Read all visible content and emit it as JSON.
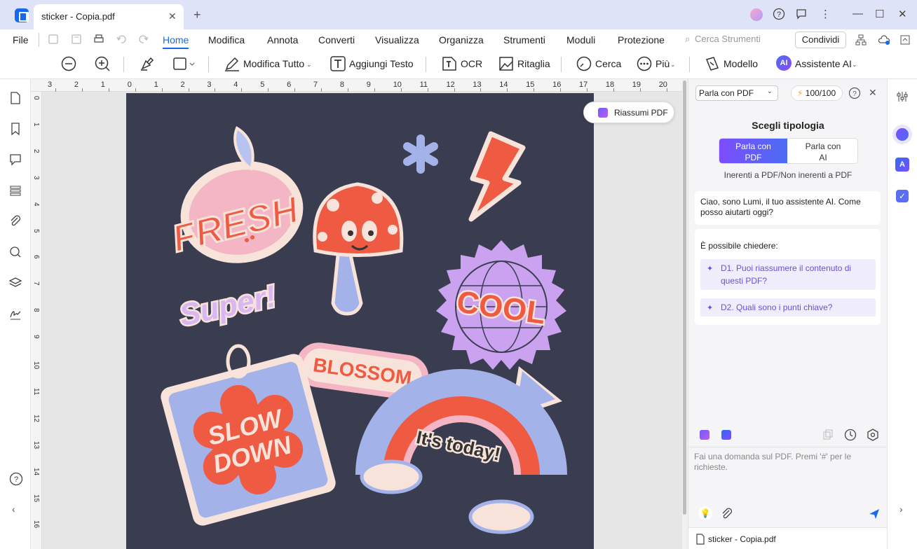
{
  "window": {
    "tab_title": "sticker - Copia.pdf",
    "tab_close_icon": "close-icon",
    "new_tab_icon": "plus-icon"
  },
  "menu": {
    "file": "File",
    "items": [
      "Home",
      "Modifica",
      "Annota",
      "Converti",
      "Visualizza",
      "Organizza",
      "Strumenti",
      "Moduli",
      "Protezione"
    ],
    "search_placeholder": "Cerca Strumenti",
    "share": "Condividi"
  },
  "toolbar": {
    "edit_all": "Modifica Tutto",
    "add_text": "Aggiungi Testo",
    "ocr": "OCR",
    "crop": "Ritaglia",
    "search": "Cerca",
    "more": "Più",
    "template": "Modello",
    "ai_assistant": "Assistente AI",
    "ai_badge": "AI"
  },
  "ruler": {
    "h_labels": [
      "3",
      "2",
      "1",
      "0",
      "1",
      "2",
      "3",
      "4",
      "5",
      "6",
      "7",
      "8",
      "9",
      "10",
      "11",
      "12",
      "13",
      "14",
      "15",
      "16",
      "17",
      "18",
      "19",
      "20",
      "2"
    ],
    "v_labels": [
      "0",
      "1",
      "2",
      "3",
      "4",
      "5",
      "6",
      "7",
      "8",
      "9",
      "10",
      "11",
      "12",
      "13",
      "14",
      "15",
      "16"
    ]
  },
  "document": {
    "summarize_button": "Riassumi PDF",
    "stickers": {
      "fresh": "FRESH",
      "super": "Super!",
      "cool": "COOL",
      "blossom": "BLOSSOM",
      "slow": "SLOW",
      "down": "DOWN",
      "today": "It's today!"
    }
  },
  "ai_panel": {
    "mode_select": "Parla con PDF",
    "credits": "100/100",
    "choose_title": "Scegli tipologia",
    "seg_pdf_1": "Parla con",
    "seg_pdf_2": "PDF",
    "seg_ai_1": "Parla con",
    "seg_ai_2": "AI",
    "seg_hint": "Inerenti a PDF/Non inerenti a PDF",
    "greeting": "Ciao, sono Lumi, il tuo assistente AI. Come posso aiutarti oggi?",
    "ask_heading": "È possibile chiedere:",
    "questions": [
      "D1. Puoi riassumere il contenuto di questi PDF?",
      "D2. Quali sono i punti chiave?"
    ],
    "input_placeholder": "Fai una domanda sul PDF. Premi '#' per le richieste.",
    "file_name": "sticker - Copia.pdf"
  },
  "colors": {
    "accent": "#1769f0",
    "page_bg": "#3a3d50",
    "ai_purple": "#7c4dff"
  }
}
